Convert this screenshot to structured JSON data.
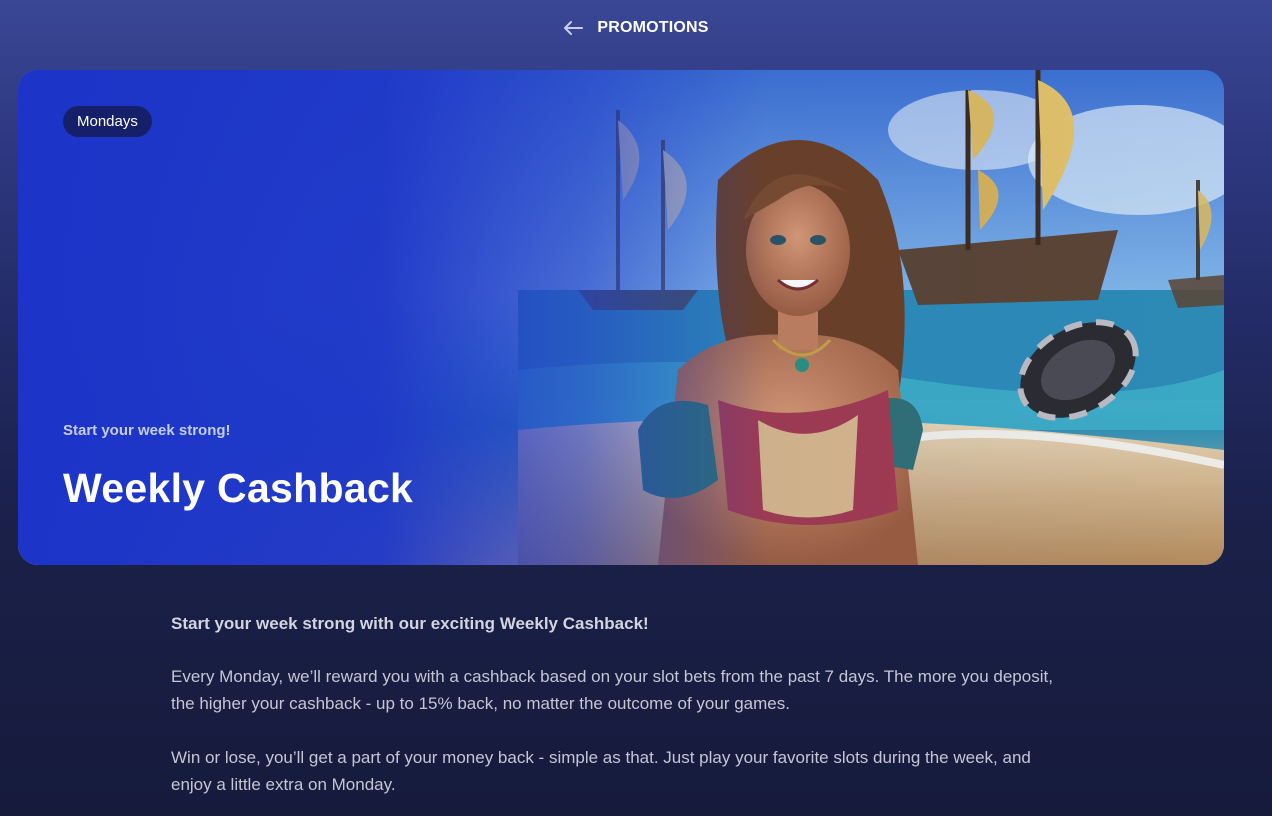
{
  "header": {
    "title": "PROMOTIONS",
    "back_icon": "arrow-left-icon"
  },
  "hero": {
    "badge": "Mondays",
    "subtitle": "Start your week strong!",
    "title": "Weekly Cashback",
    "image": "pirate-woman-beach-ships-illustration",
    "colors": {
      "overlay": "#1f3bc9",
      "badge_bg": "#16206a"
    }
  },
  "content": {
    "intro": "Start your week strong with our exciting Weekly Cashback!",
    "paragraphs": [
      "Every Monday, we’ll reward you with a cashback based on your slot bets from the past 7 days. The more you deposit, the higher your cashback - up to 15% back, no matter the outcome of your games.",
      "Win or lose, you’ll get a part of your money back - simple as that. Just play your favorite slots during the week, and enjoy a little extra on Monday."
    ]
  }
}
